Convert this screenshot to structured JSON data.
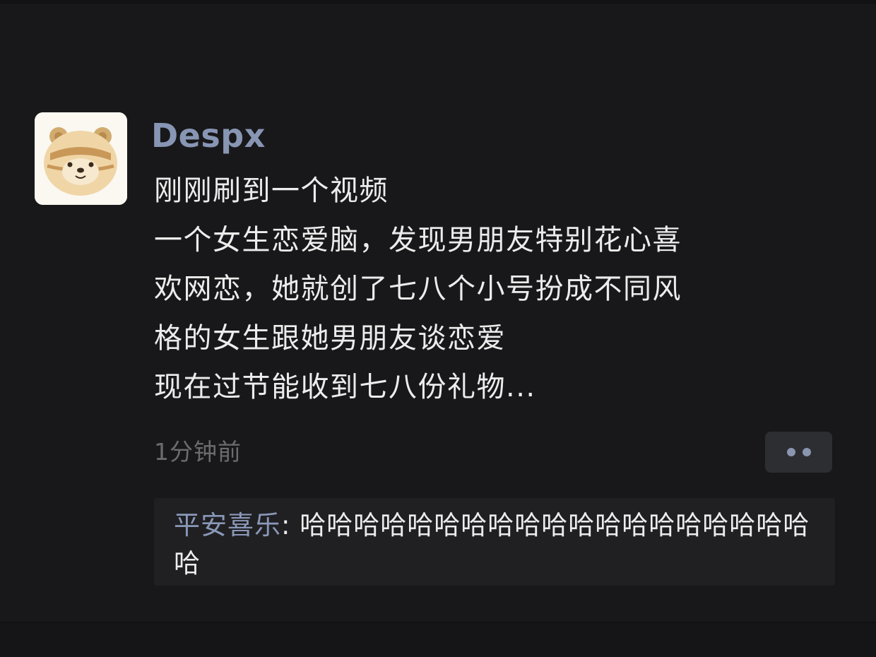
{
  "post": {
    "author": "Despx",
    "avatar_icon": "bear-avatar-icon",
    "lines": [
      "刚刚刷到一个视频",
      "一个女生恋爱脑，发现男朋友特别花心喜",
      "欢网恋，她就创了七八个小号扮成不同风",
      "格的女生跟她男朋友谈恋爱",
      "现在过节能收到七八份礼物..."
    ],
    "timestamp": "1分钟前",
    "more_icon": "more-dots-icon"
  },
  "comments": [
    {
      "author": "平安喜乐",
      "separator": ": ",
      "text": "哈哈哈哈哈哈哈哈哈哈哈哈哈哈哈哈哈哈哈哈"
    }
  ],
  "colors": {
    "background": "#18181a",
    "author_name": "#8896b4",
    "body_text": "#ececec",
    "timestamp": "#6c6c70",
    "comment_box": "#202023",
    "comment_author": "#8a98b8"
  }
}
